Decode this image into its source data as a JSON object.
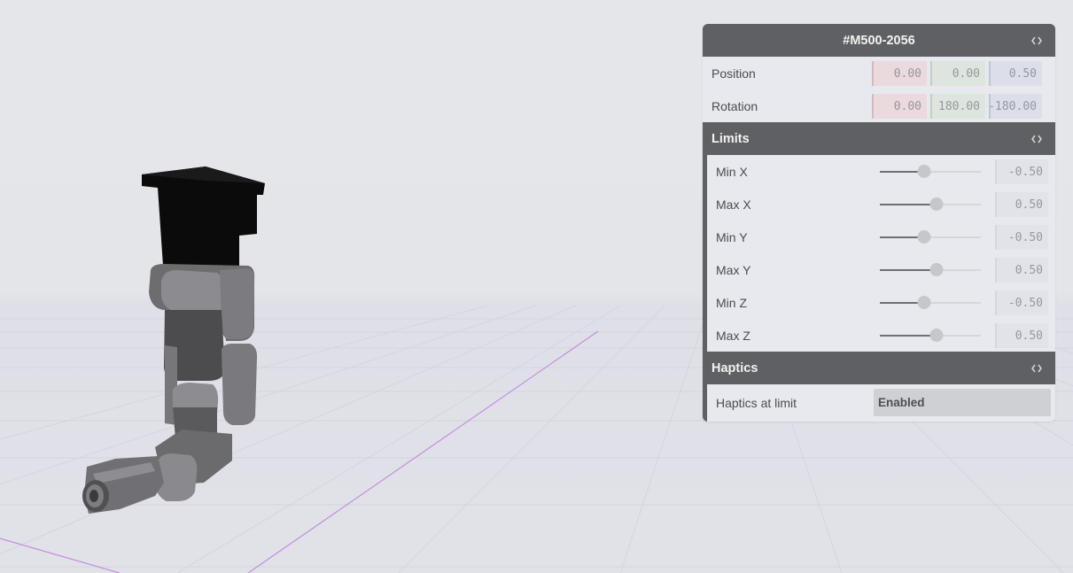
{
  "panel": {
    "title": "#M500-2056",
    "position": {
      "label": "Position",
      "x": "0.00",
      "y": "0.00",
      "z": "0.50"
    },
    "rotation": {
      "label": "Rotation",
      "x": "0.00",
      "y": "180.00",
      "z": "-180.00"
    }
  },
  "limits": {
    "title": "Limits",
    "items": [
      {
        "label": "Min X",
        "value": "-0.50",
        "slider_fraction": 0.44
      },
      {
        "label": "Max X",
        "value": "0.50",
        "slider_fraction": 0.56
      },
      {
        "label": "Min Y",
        "value": "-0.50",
        "slider_fraction": 0.44
      },
      {
        "label": "Max Y",
        "value": "0.50",
        "slider_fraction": 0.56
      },
      {
        "label": "Min Z",
        "value": "-0.50",
        "slider_fraction": 0.44
      },
      {
        "label": "Max Z",
        "value": "0.50",
        "slider_fraction": 0.56
      }
    ]
  },
  "haptics": {
    "title": "Haptics",
    "label": "Haptics at limit",
    "value": "Enabled"
  },
  "scene": {
    "object": "robot-arm",
    "axis_color": "#c38ce0"
  },
  "icons": {
    "collapse": "collapse-toggle-icon"
  },
  "colors": {
    "header_bg": "#5f6063",
    "panel_bg": "#e8e9ee",
    "x_tint": "#ead9dd",
    "y_tint": "#dde6de",
    "z_tint": "#dcdfea"
  }
}
